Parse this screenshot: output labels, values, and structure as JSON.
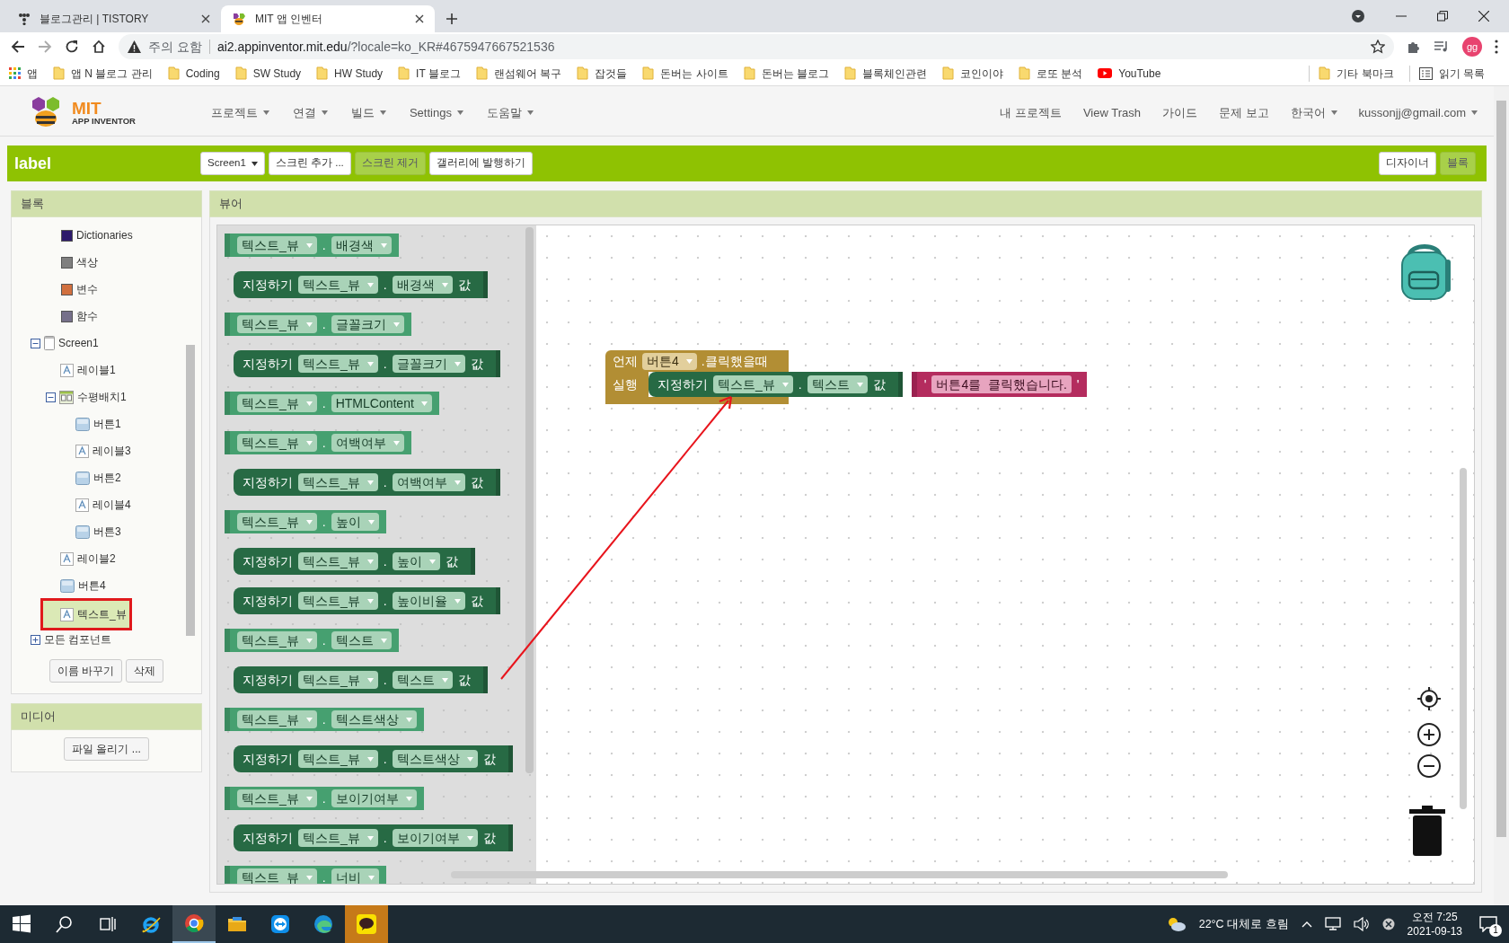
{
  "browser": {
    "tabs": [
      {
        "title": "블로그관리 | TISTORY",
        "selected": false
      },
      {
        "title": "MIT 앱 인벤터",
        "selected": true
      }
    ],
    "address": {
      "warning": "주의 요함",
      "host": "ai2.appinventor.mit.edu",
      "path": "/?locale=ko_KR#4675947667521536"
    },
    "profile": "gg",
    "bookmarks": [
      {
        "kind": "apps",
        "label": "앱"
      },
      {
        "kind": "folder",
        "label": "앱 N 블로그 관리"
      },
      {
        "kind": "folder",
        "label": "Coding"
      },
      {
        "kind": "folder",
        "label": "SW Study"
      },
      {
        "kind": "folder",
        "label": "HW Study"
      },
      {
        "kind": "folder",
        "label": "IT 블로그"
      },
      {
        "kind": "folder",
        "label": "랜섬웨어 복구"
      },
      {
        "kind": "folder",
        "label": "잡것들"
      },
      {
        "kind": "folder",
        "label": "돈버는 사이트"
      },
      {
        "kind": "folder",
        "label": "돈버는 블로그"
      },
      {
        "kind": "folder",
        "label": "블록체인관련"
      },
      {
        "kind": "folder",
        "label": "코인이야"
      },
      {
        "kind": "folder",
        "label": "로또 분석"
      },
      {
        "kind": "youtube",
        "label": "YouTube"
      }
    ],
    "bookmarks_right": [
      {
        "kind": "folder",
        "label": "기타 북마크"
      },
      {
        "kind": "reading",
        "label": "읽기 목록"
      }
    ]
  },
  "app": {
    "logo": {
      "title": "MIT",
      "subtitle": "APP INVENTOR"
    },
    "menu": [
      {
        "label": "프로젝트",
        "dropdown": true
      },
      {
        "label": "연결",
        "dropdown": true
      },
      {
        "label": "빌드",
        "dropdown": true
      },
      {
        "label": "Settings",
        "dropdown": true
      },
      {
        "label": "도움말",
        "dropdown": true
      }
    ],
    "right_menu": [
      {
        "label": "내 프로젝트",
        "dropdown": false
      },
      {
        "label": "View Trash",
        "dropdown": false
      },
      {
        "label": "가이드",
        "dropdown": false
      },
      {
        "label": "문제 보고",
        "dropdown": false
      },
      {
        "label": "한국어",
        "dropdown": true
      },
      {
        "label": "kussonjj@gmail.com",
        "dropdown": true
      }
    ]
  },
  "project": {
    "name": "label",
    "toolbar": [
      {
        "label": "Screen1",
        "dropdown": true,
        "disabled": false
      },
      {
        "label": "스크린 추가 ...",
        "dropdown": false,
        "disabled": false
      },
      {
        "label": "스크린 제거",
        "dropdown": false,
        "disabled": true
      },
      {
        "label": "갤러리에 발행하기",
        "dropdown": false,
        "disabled": false
      }
    ],
    "views": [
      {
        "label": "디자이너",
        "selected": false
      },
      {
        "label": "블록",
        "selected": true
      }
    ]
  },
  "blocks_panel": {
    "title": "블록",
    "builtin": [
      {
        "label": "Dictionaries",
        "color": "#2d1a6b"
      },
      {
        "label": "색상",
        "color": "#7f7f7f"
      },
      {
        "label": "변수",
        "color": "#d1703f"
      },
      {
        "label": "함수",
        "color": "#76708a"
      }
    ],
    "components": [
      {
        "label": "Screen1",
        "kind": "screen",
        "expanded": true,
        "selected": false,
        "children": [
          {
            "label": "레이블1",
            "kind": "label",
            "selected": false
          },
          {
            "label": "수평배치1",
            "kind": "arrangement",
            "expanded": true,
            "selected": false,
            "children": [
              {
                "label": "버튼1",
                "kind": "button",
                "selected": false
              },
              {
                "label": "레이블3",
                "kind": "label",
                "selected": false
              },
              {
                "label": "버튼2",
                "kind": "button",
                "selected": false
              },
              {
                "label": "레이블4",
                "kind": "label",
                "selected": false
              },
              {
                "label": "버튼3",
                "kind": "button",
                "selected": false
              }
            ]
          },
          {
            "label": "레이블2",
            "kind": "label",
            "selected": false
          },
          {
            "label": "버튼4",
            "kind": "button",
            "selected": false
          },
          {
            "label": "텍스트_뷰",
            "kind": "label",
            "selected": true
          }
        ]
      },
      {
        "label": "모든 컴포넌트",
        "kind": "all",
        "expanded": false,
        "selected": false
      }
    ],
    "buttons": [
      "이름 바꾸기",
      "삭제"
    ]
  },
  "media_panel": {
    "title": "미디어",
    "button": "파일 올리기 ..."
  },
  "viewer": {
    "title": "뷰어",
    "flyout": [
      {
        "kind": "getter",
        "component": "텍스트_뷰",
        "separator": ".",
        "property": "배경색"
      },
      {
        "kind": "setter",
        "verb": "지정하기",
        "component": "텍스트_뷰",
        "separator": ".",
        "property": "배경색",
        "value_label": "값"
      },
      {
        "kind": "getter",
        "component": "텍스트_뷰",
        "separator": ".",
        "property": "글꼴크기"
      },
      {
        "kind": "setter",
        "verb": "지정하기",
        "component": "텍스트_뷰",
        "separator": ".",
        "property": "글꼴크기",
        "value_label": "값"
      },
      {
        "kind": "getter",
        "component": "텍스트_뷰",
        "separator": ".",
        "property": "HTMLContent"
      },
      {
        "kind": "getter",
        "component": "텍스트_뷰",
        "separator": ".",
        "property": "여백여부"
      },
      {
        "kind": "setter",
        "verb": "지정하기",
        "component": "텍스트_뷰",
        "separator": ".",
        "property": "여백여부",
        "value_label": "값"
      },
      {
        "kind": "getter",
        "component": "텍스트_뷰",
        "separator": ".",
        "property": "높이"
      },
      {
        "kind": "setter",
        "verb": "지정하기",
        "component": "텍스트_뷰",
        "separator": ".",
        "property": "높이",
        "value_label": "값"
      },
      {
        "kind": "setter",
        "verb": "지정하기",
        "component": "텍스트_뷰",
        "separator": ".",
        "property": "높이비율",
        "value_label": "값"
      },
      {
        "kind": "getter",
        "component": "텍스트_뷰",
        "separator": ".",
        "property": "텍스트"
      },
      {
        "kind": "setter",
        "verb": "지정하기",
        "component": "텍스트_뷰",
        "separator": ".",
        "property": "텍스트",
        "value_label": "값"
      },
      {
        "kind": "getter",
        "component": "텍스트_뷰",
        "separator": ".",
        "property": "텍스트색상"
      },
      {
        "kind": "setter",
        "verb": "지정하기",
        "component": "텍스트_뷰",
        "separator": ".",
        "property": "텍스트색상",
        "value_label": "값"
      },
      {
        "kind": "getter",
        "component": "텍스트_뷰",
        "separator": ".",
        "property": "보이기여부"
      },
      {
        "kind": "setter",
        "verb": "지정하기",
        "component": "텍스트_뷰",
        "separator": ".",
        "property": "보이기여부",
        "value_label": "값"
      },
      {
        "kind": "getter",
        "component": "텍스트_뷰",
        "separator": ".",
        "property": "너비"
      }
    ],
    "event": {
      "keyword": "언제",
      "component": "버튼4",
      "event": ".클릭했을때",
      "do_label": "실행",
      "action": {
        "verb": "지정하기",
        "component": "텍스트_뷰",
        "separator": ".",
        "property": "텍스트",
        "value_label": "값"
      },
      "string": {
        "quote_open": "'",
        "text": "버튼4를  클릭했습니다.",
        "quote_close": "'"
      }
    }
  },
  "taskbar": {
    "apps": [
      {
        "kind": "ie",
        "active": false,
        "attention": false
      },
      {
        "kind": "chrome",
        "active": true,
        "attention": false
      },
      {
        "kind": "explorer",
        "active": false,
        "attention": false
      },
      {
        "kind": "teamviewer",
        "active": false,
        "attention": false
      },
      {
        "kind": "edge",
        "active": false,
        "attention": false
      },
      {
        "kind": "kakaotalk",
        "active": false,
        "attention": true
      }
    ],
    "weather": "22°C 대체로 흐림",
    "time": "오전 7:25",
    "date": "2021-09-13",
    "notifications": "1"
  }
}
